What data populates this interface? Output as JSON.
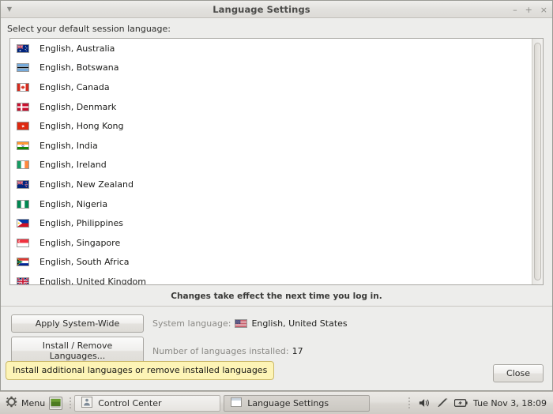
{
  "window": {
    "title": "Language Settings",
    "menu_arrow_icon": "chevron-down-icon",
    "minimize_label": "–",
    "maximize_label": "+",
    "close_label": "×"
  },
  "main": {
    "prompt": "Select your default session language:",
    "notice": "Changes take effect the next time you log in.",
    "languages": [
      {
        "label": "English, Australia",
        "flag": "au"
      },
      {
        "label": "English, Botswana",
        "flag": "bw"
      },
      {
        "label": "English, Canada",
        "flag": "ca"
      },
      {
        "label": "English, Denmark",
        "flag": "dk"
      },
      {
        "label": "English, Hong Kong",
        "flag": "hk"
      },
      {
        "label": "English, India",
        "flag": "in"
      },
      {
        "label": "English, Ireland",
        "flag": "ie"
      },
      {
        "label": "English, New Zealand",
        "flag": "nz"
      },
      {
        "label": "English, Nigeria",
        "flag": "ng"
      },
      {
        "label": "English, Philippines",
        "flag": "ph"
      },
      {
        "label": "English, Singapore",
        "flag": "sg"
      },
      {
        "label": "English, South Africa",
        "flag": "za"
      },
      {
        "label": "English, United Kingdom",
        "flag": "gb"
      }
    ]
  },
  "actions": {
    "apply_label": "Apply System-Wide",
    "install_label": "Install / Remove Languages...",
    "system_language_label": "System language:",
    "system_language_value": "English, United States",
    "system_language_flag": "us",
    "installed_count_label": "Number of languages installed:",
    "installed_count_value": "17",
    "close_label": "Close"
  },
  "tooltip": {
    "text": "Install additional languages or remove installed languages",
    "background": "#fdf4b6",
    "border": "#cbb96a"
  },
  "taskbar": {
    "menu_label": "Menu",
    "menu_icon": "gear-icon",
    "desktop_icon": "show-desktop-icon",
    "tasks": [
      {
        "label": "Control Center",
        "icon": "control-center-icon",
        "active": false
      },
      {
        "label": "Language Settings",
        "icon": "window-icon",
        "active": true
      }
    ],
    "tray": {
      "volume_icon": "speaker-icon",
      "bluetooth_icon": "pen-icon",
      "battery_icon": "battery-icon",
      "clock": "Tue Nov  3, 18:09"
    }
  }
}
